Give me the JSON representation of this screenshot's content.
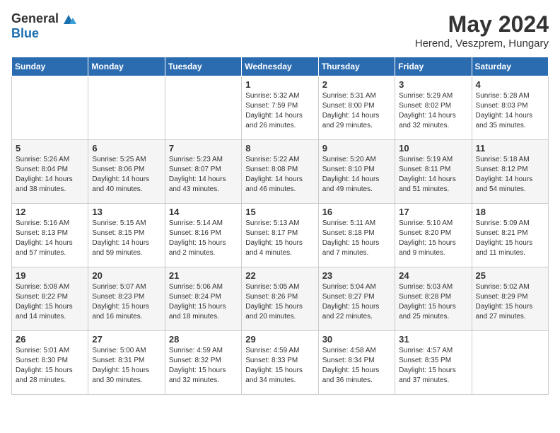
{
  "logo": {
    "general": "General",
    "blue": "Blue"
  },
  "title": {
    "month_year": "May 2024",
    "location": "Herend, Veszprem, Hungary"
  },
  "headers": [
    "Sunday",
    "Monday",
    "Tuesday",
    "Wednesday",
    "Thursday",
    "Friday",
    "Saturday"
  ],
  "weeks": [
    [
      {
        "day": "",
        "content": ""
      },
      {
        "day": "",
        "content": ""
      },
      {
        "day": "",
        "content": ""
      },
      {
        "day": "1",
        "content": "Sunrise: 5:32 AM\nSunset: 7:59 PM\nDaylight: 14 hours\nand 26 minutes."
      },
      {
        "day": "2",
        "content": "Sunrise: 5:31 AM\nSunset: 8:00 PM\nDaylight: 14 hours\nand 29 minutes."
      },
      {
        "day": "3",
        "content": "Sunrise: 5:29 AM\nSunset: 8:02 PM\nDaylight: 14 hours\nand 32 minutes."
      },
      {
        "day": "4",
        "content": "Sunrise: 5:28 AM\nSunset: 8:03 PM\nDaylight: 14 hours\nand 35 minutes."
      }
    ],
    [
      {
        "day": "5",
        "content": "Sunrise: 5:26 AM\nSunset: 8:04 PM\nDaylight: 14 hours\nand 38 minutes."
      },
      {
        "day": "6",
        "content": "Sunrise: 5:25 AM\nSunset: 8:06 PM\nDaylight: 14 hours\nand 40 minutes."
      },
      {
        "day": "7",
        "content": "Sunrise: 5:23 AM\nSunset: 8:07 PM\nDaylight: 14 hours\nand 43 minutes."
      },
      {
        "day": "8",
        "content": "Sunrise: 5:22 AM\nSunset: 8:08 PM\nDaylight: 14 hours\nand 46 minutes."
      },
      {
        "day": "9",
        "content": "Sunrise: 5:20 AM\nSunset: 8:10 PM\nDaylight: 14 hours\nand 49 minutes."
      },
      {
        "day": "10",
        "content": "Sunrise: 5:19 AM\nSunset: 8:11 PM\nDaylight: 14 hours\nand 51 minutes."
      },
      {
        "day": "11",
        "content": "Sunrise: 5:18 AM\nSunset: 8:12 PM\nDaylight: 14 hours\nand 54 minutes."
      }
    ],
    [
      {
        "day": "12",
        "content": "Sunrise: 5:16 AM\nSunset: 8:13 PM\nDaylight: 14 hours\nand 57 minutes."
      },
      {
        "day": "13",
        "content": "Sunrise: 5:15 AM\nSunset: 8:15 PM\nDaylight: 14 hours\nand 59 minutes."
      },
      {
        "day": "14",
        "content": "Sunrise: 5:14 AM\nSunset: 8:16 PM\nDaylight: 15 hours\nand 2 minutes."
      },
      {
        "day": "15",
        "content": "Sunrise: 5:13 AM\nSunset: 8:17 PM\nDaylight: 15 hours\nand 4 minutes."
      },
      {
        "day": "16",
        "content": "Sunrise: 5:11 AM\nSunset: 8:18 PM\nDaylight: 15 hours\nand 7 minutes."
      },
      {
        "day": "17",
        "content": "Sunrise: 5:10 AM\nSunset: 8:20 PM\nDaylight: 15 hours\nand 9 minutes."
      },
      {
        "day": "18",
        "content": "Sunrise: 5:09 AM\nSunset: 8:21 PM\nDaylight: 15 hours\nand 11 minutes."
      }
    ],
    [
      {
        "day": "19",
        "content": "Sunrise: 5:08 AM\nSunset: 8:22 PM\nDaylight: 15 hours\nand 14 minutes."
      },
      {
        "day": "20",
        "content": "Sunrise: 5:07 AM\nSunset: 8:23 PM\nDaylight: 15 hours\nand 16 minutes."
      },
      {
        "day": "21",
        "content": "Sunrise: 5:06 AM\nSunset: 8:24 PM\nDaylight: 15 hours\nand 18 minutes."
      },
      {
        "day": "22",
        "content": "Sunrise: 5:05 AM\nSunset: 8:26 PM\nDaylight: 15 hours\nand 20 minutes."
      },
      {
        "day": "23",
        "content": "Sunrise: 5:04 AM\nSunset: 8:27 PM\nDaylight: 15 hours\nand 22 minutes."
      },
      {
        "day": "24",
        "content": "Sunrise: 5:03 AM\nSunset: 8:28 PM\nDaylight: 15 hours\nand 25 minutes."
      },
      {
        "day": "25",
        "content": "Sunrise: 5:02 AM\nSunset: 8:29 PM\nDaylight: 15 hours\nand 27 minutes."
      }
    ],
    [
      {
        "day": "26",
        "content": "Sunrise: 5:01 AM\nSunset: 8:30 PM\nDaylight: 15 hours\nand 28 minutes."
      },
      {
        "day": "27",
        "content": "Sunrise: 5:00 AM\nSunset: 8:31 PM\nDaylight: 15 hours\nand 30 minutes."
      },
      {
        "day": "28",
        "content": "Sunrise: 4:59 AM\nSunset: 8:32 PM\nDaylight: 15 hours\nand 32 minutes."
      },
      {
        "day": "29",
        "content": "Sunrise: 4:59 AM\nSunset: 8:33 PM\nDaylight: 15 hours\nand 34 minutes."
      },
      {
        "day": "30",
        "content": "Sunrise: 4:58 AM\nSunset: 8:34 PM\nDaylight: 15 hours\nand 36 minutes."
      },
      {
        "day": "31",
        "content": "Sunrise: 4:57 AM\nSunset: 8:35 PM\nDaylight: 15 hours\nand 37 minutes."
      },
      {
        "day": "",
        "content": ""
      }
    ]
  ]
}
